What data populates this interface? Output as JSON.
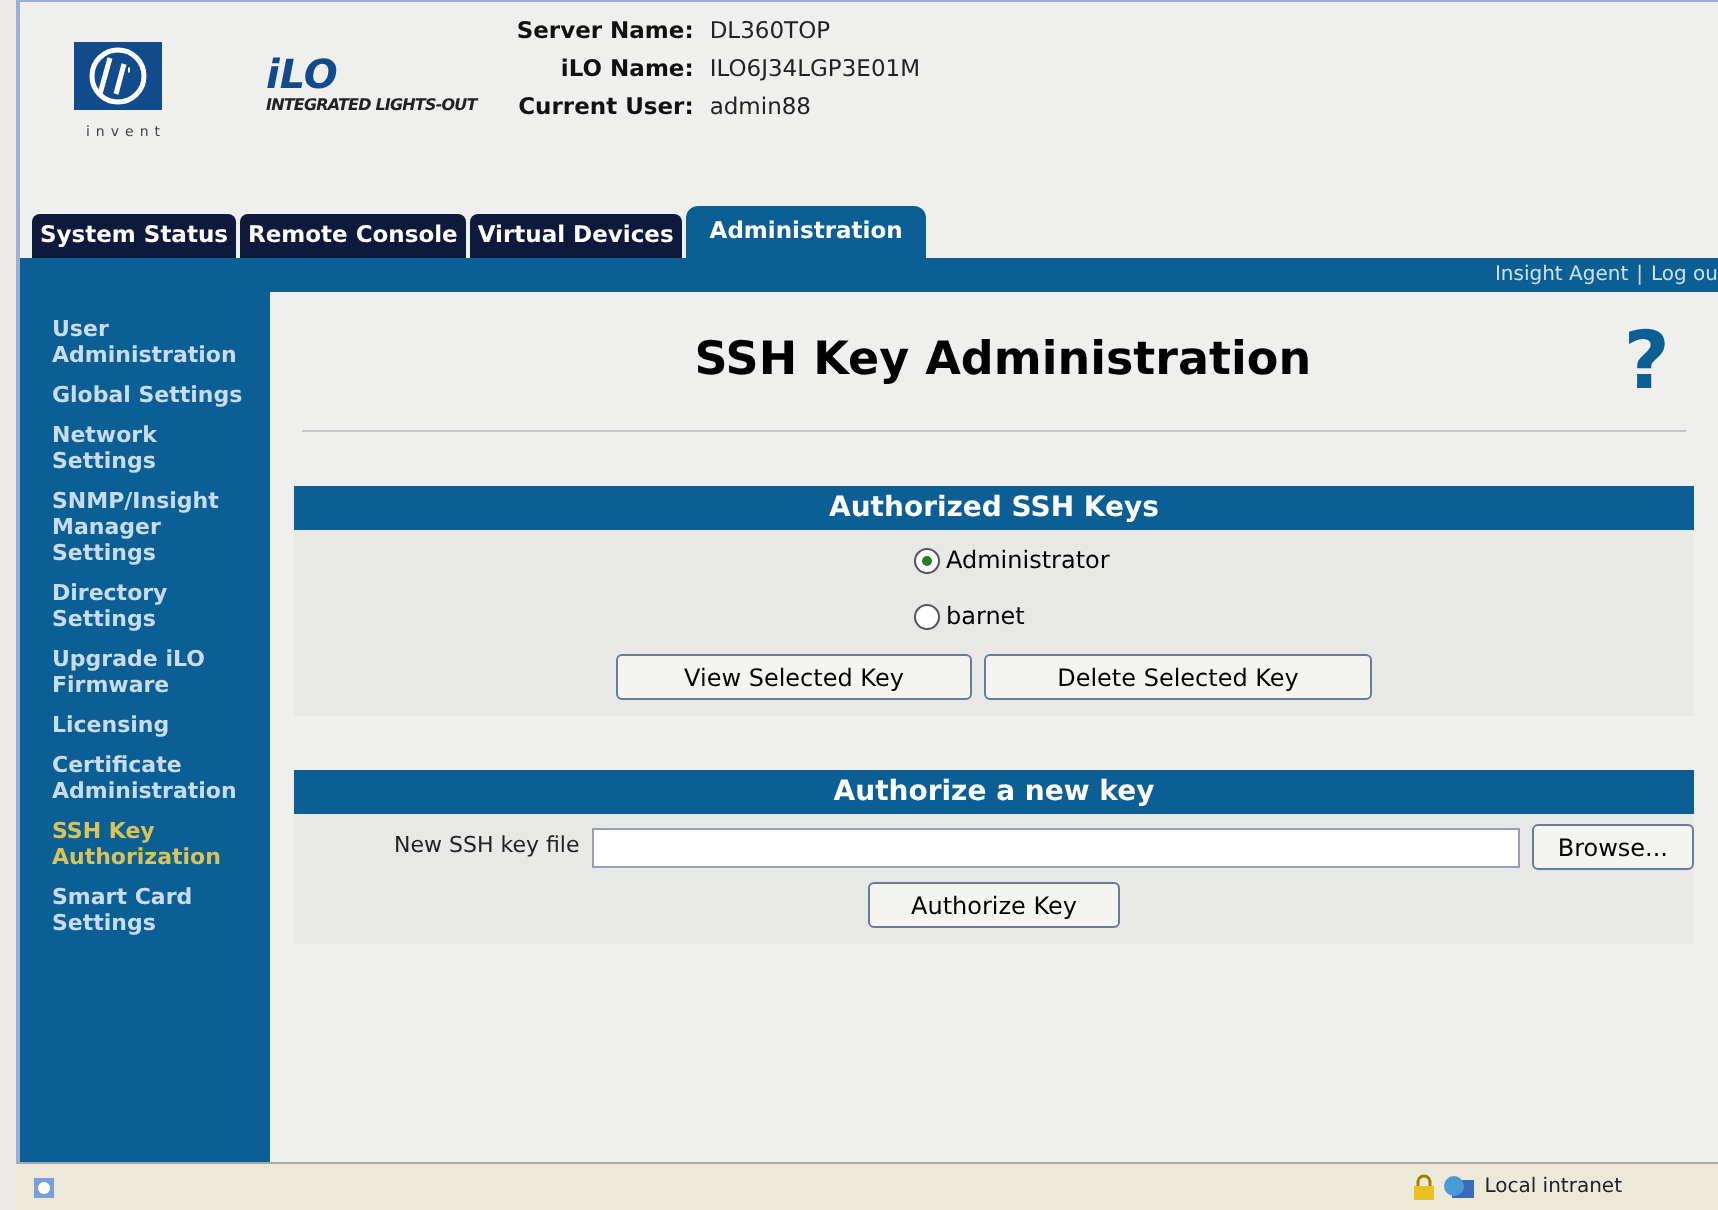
{
  "header": {
    "logo_text": "invent",
    "product": "iLO",
    "product_subtitle": "INTEGRATED LIGHTS-OUT",
    "info": [
      {
        "label": "Server Name:",
        "value": "DL360TOP"
      },
      {
        "label": "iLO Name:",
        "value": "ILO6J34LGP3E01M"
      },
      {
        "label": "Current User:",
        "value": "admin88"
      }
    ]
  },
  "tabs": [
    {
      "label": "System Status",
      "selected": false
    },
    {
      "label": "Remote Console",
      "selected": false
    },
    {
      "label": "Virtual Devices",
      "selected": false
    },
    {
      "label": "Administration",
      "selected": true
    }
  ],
  "top_links": [
    "Insight Agent",
    "|",
    "Log ou"
  ],
  "sidebar": {
    "items": [
      {
        "label": "User Administration",
        "selected": false
      },
      {
        "label": "Global Settings",
        "selected": false
      },
      {
        "label": "Network Settings",
        "selected": false
      },
      {
        "label": "SNMP/Insight Manager Settings",
        "selected": false
      },
      {
        "label": "Directory Settings",
        "selected": false
      },
      {
        "label": "Upgrade iLO Firmware",
        "selected": false
      },
      {
        "label": "Licensing",
        "selected": false
      },
      {
        "label": "Certificate Administration",
        "selected": false
      },
      {
        "label": "SSH Key Authorization",
        "selected": true
      },
      {
        "label": "Smart Card Settings",
        "selected": false
      }
    ]
  },
  "page": {
    "title": "SSH Key Administration",
    "help": "?"
  },
  "authorized_keys": {
    "heading": "Authorized SSH Keys",
    "keys": [
      {
        "label": "Administrator",
        "selected": true
      },
      {
        "label": "barnet",
        "selected": false
      }
    ],
    "buttons": [
      "View Selected Key",
      "Delete Selected Key"
    ]
  },
  "new_key": {
    "heading": "Authorize a new key",
    "field_label": "New SSH key file",
    "browse": "Browse...",
    "button": "Authorize Key"
  },
  "status_bar": {
    "zone": "Local intranet"
  }
}
